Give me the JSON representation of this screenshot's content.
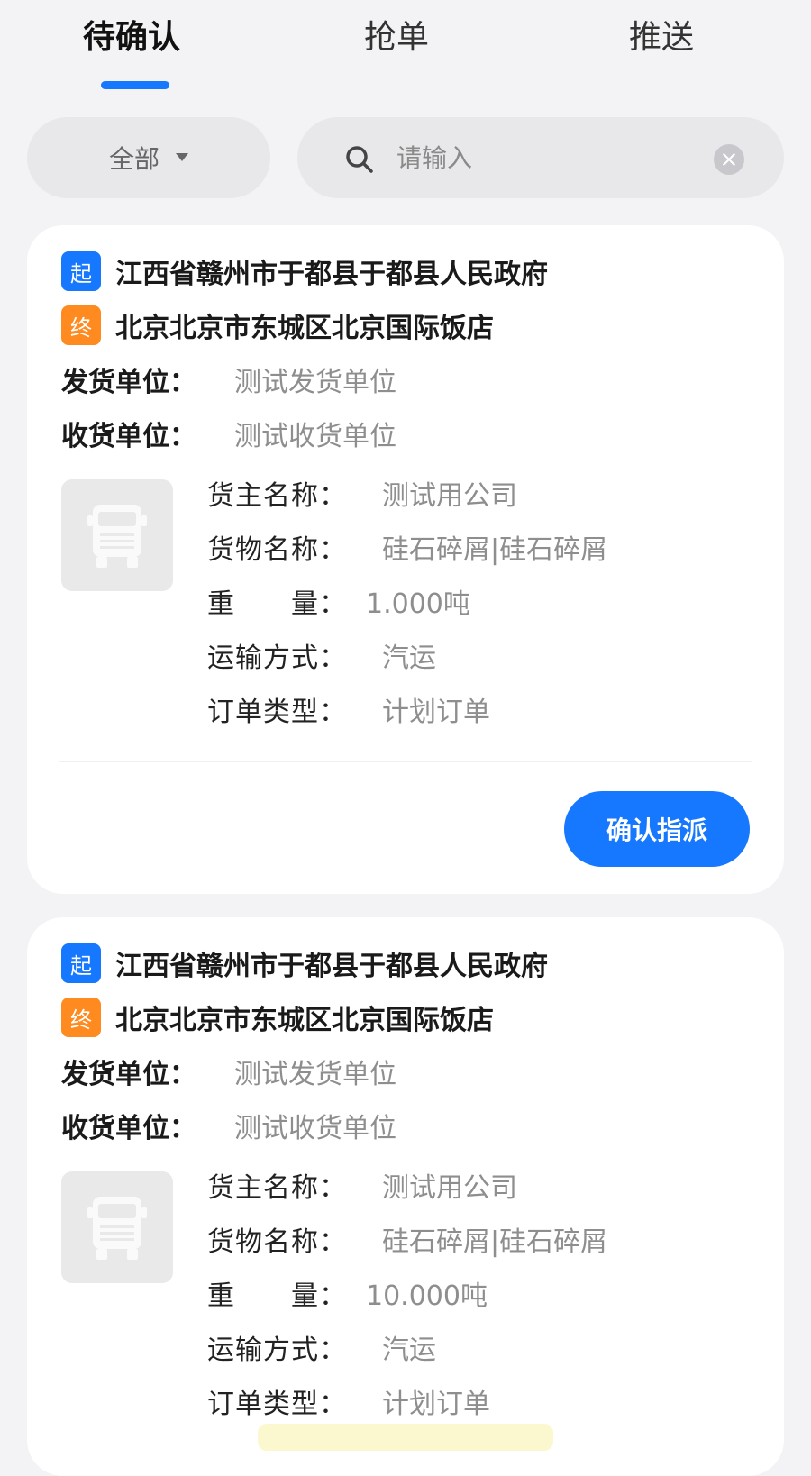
{
  "tabs": [
    {
      "label": "待确认",
      "active": true
    },
    {
      "label": "抢单",
      "active": false
    },
    {
      "label": "推送",
      "active": false
    }
  ],
  "filter": {
    "selected": "全部"
  },
  "search": {
    "placeholder": "请输入",
    "value": ""
  },
  "colors": {
    "primary": "#1677ff",
    "start_badge": "#1677ff",
    "end_badge": "#ff8a1f"
  },
  "orders": [
    {
      "start_badge": "起",
      "start": "江西省赣州市于都县于都县人民政府",
      "end_badge": "终",
      "end": "北京北京市东城区北京国际饭店",
      "shipper_label": "发货单位：",
      "shipper": "测试发货单位",
      "receiver_label": "收货单位：",
      "receiver": "测试收货单位",
      "owner_label": "货主名称：",
      "owner": "测试用公司",
      "goods_label": "货物名称：",
      "goods": "硅石碎屑|硅石碎屑",
      "weight_label": "重　　量：",
      "weight": "1.000吨",
      "transport_label": "运输方式：",
      "transport": "汽运",
      "type_label": "订单类型：",
      "type": "计划订单",
      "action": "确认指派"
    },
    {
      "start_badge": "起",
      "start": "江西省赣州市于都县于都县人民政府",
      "end_badge": "终",
      "end": "北京北京市东城区北京国际饭店",
      "shipper_label": "发货单位：",
      "shipper": "测试发货单位",
      "receiver_label": "收货单位：",
      "receiver": "测试收货单位",
      "owner_label": "货主名称：",
      "owner": "测试用公司",
      "goods_label": "货物名称：",
      "goods": "硅石碎屑|硅石碎屑",
      "weight_label": "重　　量：",
      "weight": "10.000吨",
      "transport_label": "运输方式：",
      "transport": "汽运",
      "type_label": "订单类型：",
      "type": "计划订单"
    }
  ]
}
